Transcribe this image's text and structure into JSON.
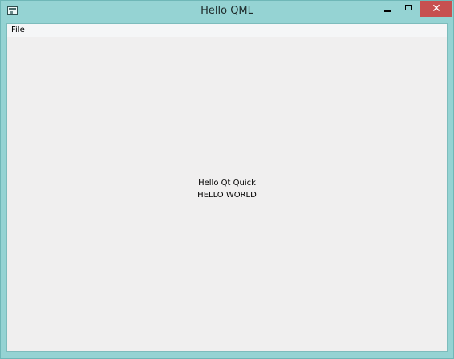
{
  "window": {
    "title": "Hello QML",
    "close_glyph": "✕"
  },
  "menubar": {
    "items": [
      "File"
    ]
  },
  "content": {
    "line1": "Hello Qt Quick",
    "line2": "HELLO WORLD"
  },
  "icons": {
    "app": "app-window-icon",
    "minimize": "minimize-icon",
    "maximize": "maximize-icon",
    "close": "close-icon"
  },
  "colors": {
    "titlebar": "#95d3d3",
    "close_button": "#c75050",
    "client_background": "#f0efef"
  }
}
